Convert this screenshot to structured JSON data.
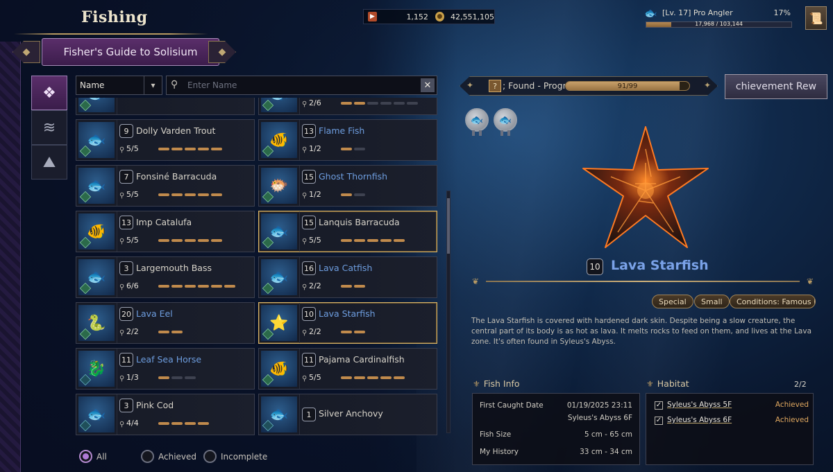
{
  "header": {
    "title": "Fishing",
    "guide_title": "Fisher's Guide to Solisium",
    "currency_1": "1,152",
    "currency_2": "42,551,105",
    "profile_name": "[Lv. 17] Pro Angler",
    "profile_percent": "17%",
    "xp_text": "17,968 / 103,144",
    "xp_fraction": 0.17
  },
  "categories": [
    {
      "icon": "diamond-pattern-icon",
      "active": true
    },
    {
      "icon": "wave-icon",
      "active": false
    },
    {
      "icon": "mountain-icon",
      "active": false
    }
  ],
  "search": {
    "sort_value": "Name",
    "placeholder": "Enter Name"
  },
  "fish_list": [
    {
      "level": "",
      "name": "",
      "count": "",
      "filled": 0,
      "total": 0,
      "rare": false,
      "partial": true,
      "col": 0,
      "glyph": "🐟"
    },
    {
      "level": "",
      "name": "",
      "count": "2/6",
      "filled": 2,
      "total": 6,
      "rare": false,
      "partial": true,
      "col": 1,
      "glyph": "🐟"
    },
    {
      "level": "9",
      "name": "Dolly Varden Trout",
      "count": "5/5",
      "filled": 5,
      "total": 5,
      "rare": false,
      "col": 0,
      "glyph": "🐟"
    },
    {
      "level": "13",
      "name": "Flame Fish",
      "count": "1/2",
      "filled": 1,
      "total": 2,
      "rare": true,
      "col": 1,
      "glyph": "🐠"
    },
    {
      "level": "7",
      "name": "Fonsiné Barracuda",
      "count": "5/5",
      "filled": 5,
      "total": 5,
      "rare": false,
      "col": 0,
      "glyph": "🐟"
    },
    {
      "level": "15",
      "name": "Ghost Thornfish",
      "count": "1/2",
      "filled": 1,
      "total": 2,
      "rare": true,
      "col": 1,
      "glyph": "🐡"
    },
    {
      "level": "13",
      "name": "Imp Catalufa",
      "count": "5/5",
      "filled": 5,
      "total": 5,
      "rare": false,
      "col": 0,
      "glyph": "🐠"
    },
    {
      "level": "15",
      "name": "Lanquis Barracuda",
      "count": "5/5",
      "filled": 5,
      "total": 5,
      "rare": false,
      "selected": true,
      "col": 1,
      "glyph": "🐟"
    },
    {
      "level": "3",
      "name": "Largemouth Bass",
      "count": "6/6",
      "filled": 6,
      "total": 6,
      "rare": false,
      "col": 0,
      "glyph": "🐟"
    },
    {
      "level": "16",
      "name": "Lava Catfish",
      "count": "2/2",
      "filled": 2,
      "total": 2,
      "rare": true,
      "col": 1,
      "glyph": "🐟"
    },
    {
      "level": "20",
      "name": "Lava Eel",
      "count": "2/2",
      "filled": 2,
      "total": 2,
      "rare": true,
      "col": 0,
      "glyph": "🐍"
    },
    {
      "level": "10",
      "name": "Lava Starfish",
      "count": "2/2",
      "filled": 2,
      "total": 2,
      "rare": true,
      "selected": true,
      "col": 1,
      "glyph": "⭐"
    },
    {
      "level": "11",
      "name": "Leaf Sea Horse",
      "count": "1/3",
      "filled": 1,
      "total": 3,
      "rare": true,
      "teal": true,
      "col": 0,
      "glyph": "🐉"
    },
    {
      "level": "11",
      "name": "Pajama Cardinalfish",
      "count": "5/5",
      "filled": 5,
      "total": 5,
      "rare": false,
      "col": 1,
      "glyph": "🐠"
    },
    {
      "level": "3",
      "name": "Pink Cod",
      "count": "4/4",
      "filled": 4,
      "total": 4,
      "rare": false,
      "teal": true,
      "col": 0,
      "glyph": "🐟"
    },
    {
      "level": "1",
      "name": "Silver Anchovy",
      "count": "",
      "filled": 0,
      "total": 0,
      "rare": false,
      "teal": true,
      "col": 1,
      "glyph": "🐟"
    }
  ],
  "filters": [
    "All",
    "Achieved",
    "Incomplete"
  ],
  "progress": {
    "label": "; Found - Progr",
    "text": "91/99",
    "fraction": 0.919,
    "achievement_button": "chievement Rew"
  },
  "detail": {
    "level": "10",
    "name": "Lava Starfish",
    "tags": [
      "Special",
      "Small",
      "Conditions: Famous Fishi"
    ],
    "description": "The Lava Starfish is covered with hardened dark skin. Despite being a slow creature, the central part of its body is as hot as lava. It melts rocks to feed on them, and lives at the Lava zone. It's often found in Syleus's Abyss.",
    "fish_info_title": "Fish Info",
    "first_caught_label": "First Caught Date",
    "first_caught_date": "01/19/2025 23:11",
    "first_caught_place": "Syleus's Abyss 6F",
    "size_label": "Fish Size",
    "size_value": "5 cm - 65 cm",
    "history_label": "My History",
    "history_value": "33 cm - 34 cm",
    "habitat_title": "Habitat",
    "habitat_count": "2/2",
    "habitats": [
      {
        "name": "Syleus's Abyss 5F",
        "status": "Achieved"
      },
      {
        "name": "Syleus's Abyss 6F",
        "status": "Achieved"
      }
    ]
  },
  "colors": {
    "accent_purple": "#5a2e6a",
    "rare_blue": "#6e9ee0",
    "progress_gold": "#c08a4c",
    "achieved_orange": "#e0a860"
  }
}
